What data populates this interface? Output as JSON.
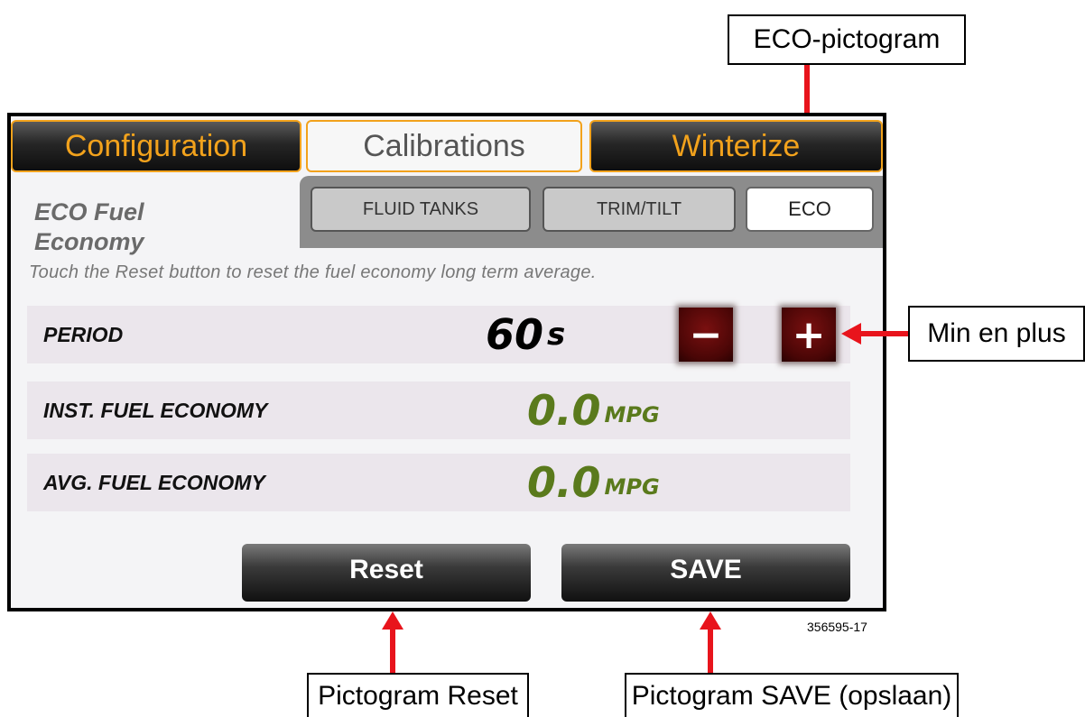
{
  "tabs": {
    "configuration": "Configuration",
    "calibrations": "Calibrations",
    "winterize": "Winterize"
  },
  "subtabs": {
    "fluid_tanks": "FLUID TANKS",
    "trim_tilt": "TRIM/TILT",
    "eco": "ECO"
  },
  "page": {
    "title_line1": "ECO Fuel",
    "title_line2": "Economy",
    "hint": "Touch the Reset button to reset the fuel economy long term average."
  },
  "rows": {
    "period": {
      "label": "PERIOD",
      "value": "60",
      "unit": "s",
      "minus": "−",
      "plus": "+"
    },
    "inst": {
      "label": "INST. FUEL ECONOMY",
      "value": "0.0",
      "unit": "MPG"
    },
    "avg": {
      "label": "AVG. FUEL ECONOMY",
      "value": "0.0",
      "unit": "MPG"
    }
  },
  "buttons": {
    "reset": "Reset",
    "save": "SAVE"
  },
  "figure_code": "356595-17",
  "callouts": {
    "eco": "ECO-pictogram",
    "minplus": "Min en plus",
    "reset": "Pictogram Reset",
    "save": "Pictogram SAVE (opslaan)"
  },
  "colors": {
    "accent_orange": "#f2a21c",
    "value_green": "#5a7a1c",
    "arrow_red": "#e8141c",
    "button_red": "#6a0a0a"
  }
}
